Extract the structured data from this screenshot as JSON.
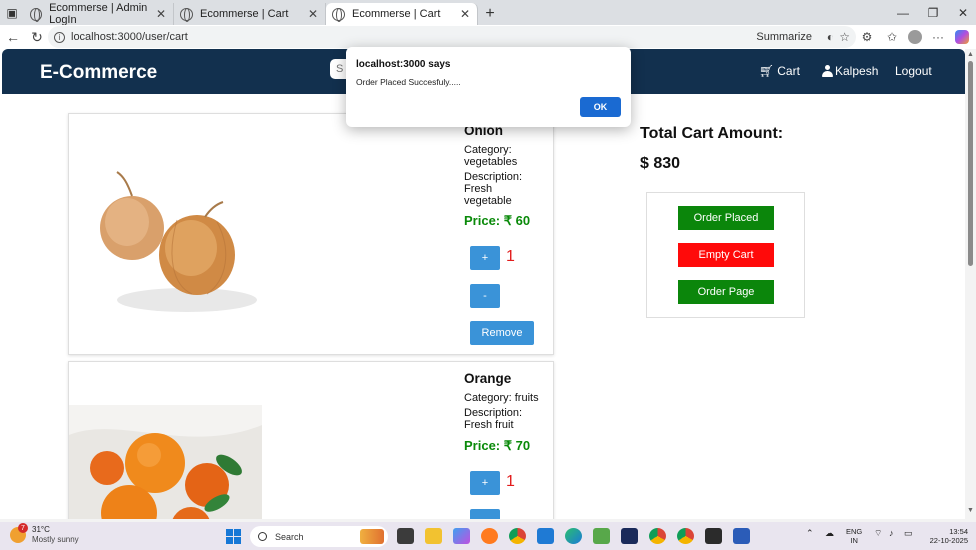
{
  "browser": {
    "tabs": [
      {
        "label": "Ecommerse | Admin LogIn",
        "active": false
      },
      {
        "label": "Ecommerse | Cart",
        "active": false
      },
      {
        "label": "Ecommerse | Cart",
        "active": true
      }
    ],
    "url": "localhost:3000/user/cart",
    "summarize_label": "Summarize"
  },
  "navbar": {
    "brand": "E-Commerce",
    "search_placeholder": "S",
    "links": {
      "cart": "Cart",
      "user": "Kalpesh",
      "logout": "Logout"
    }
  },
  "products": [
    {
      "name": "Onion",
      "category": "Category: vegetables",
      "description": "Description: Fresh vegetable",
      "price": "Price: ₹ 60",
      "quantity": "1",
      "plus": "+",
      "minus": "-",
      "remove": "Remove"
    },
    {
      "name": "Orange",
      "category": "Category: fruits",
      "description": "Description: Fresh fruit",
      "price": "Price: ₹ 70",
      "quantity": "1",
      "plus": "+"
    }
  ],
  "summary": {
    "total_label": "Total Cart Amount:",
    "total_amount": "$ 830",
    "buttons": {
      "order_placed": "Order Placed",
      "empty_cart": "Empty Cart",
      "order_page": "Order Page"
    }
  },
  "dialog": {
    "title": "localhost:3000 says",
    "message": "Order Placed Succesfuly.....",
    "ok": "OK"
  },
  "taskbar": {
    "weather_badge": "7",
    "temperature": "31°C",
    "weather": "Mostly sunny",
    "search": "Search",
    "lang_line1": "ENG",
    "lang_line2": "IN",
    "time": "13:54",
    "date": "22-10-2025"
  },
  "colors": {
    "navbar": "#12304e",
    "price_green": "#0a8a0a",
    "qty_red": "#e21c1c",
    "blue_button": "#3a93d8",
    "order_green": "#0b860b",
    "empty_red": "#ff0a0a",
    "dialog_ok": "#1a6ad2"
  }
}
